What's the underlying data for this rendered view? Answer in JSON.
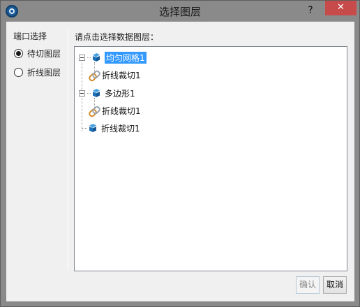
{
  "window": {
    "title": "选择图层",
    "help_label": "?",
    "close_label": "✕"
  },
  "left_panel": {
    "group_label": "端口选择",
    "options": [
      {
        "label": "待切图层",
        "checked": true
      },
      {
        "label": "折线图层",
        "checked": false
      }
    ]
  },
  "right_panel": {
    "label": "请点击选择数据图层：",
    "tree": [
      {
        "label": "均匀网格1",
        "icon": "cube-icon",
        "selected": true
      },
      {
        "label": "折线裁切1",
        "icon": "link-icon",
        "selected": false
      },
      {
        "label": "多边形1",
        "icon": "cube-icon",
        "selected": false
      },
      {
        "label": "折线裁切1",
        "icon": "link-icon",
        "selected": false
      },
      {
        "label": "折线裁切1",
        "icon": "cube-icon",
        "selected": false
      }
    ]
  },
  "buttons": {
    "ok_label": "确认",
    "cancel_label": "取消"
  },
  "colors": {
    "selection": "#3399ff",
    "close_button": "#c74b4b"
  }
}
